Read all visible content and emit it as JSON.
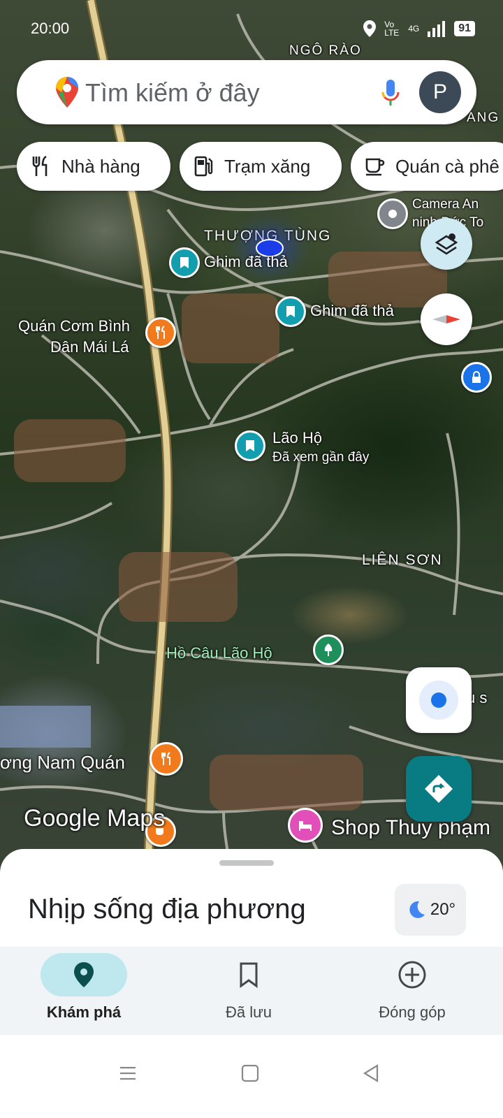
{
  "status_bar": {
    "time": "20:00",
    "network": "Vo LTE",
    "signal": "4G",
    "battery": "91"
  },
  "search": {
    "placeholder": "Tìm kiếm ở đây",
    "avatar_letter": "P"
  },
  "chips": [
    {
      "label": "Nhà hàng",
      "icon": "restaurant-icon"
    },
    {
      "label": "Trạm xăng",
      "icon": "gas-station-icon"
    },
    {
      "label": "Quán cà phê",
      "icon": "coffee-icon"
    }
  ],
  "map_labels": {
    "ngo_rao": "NGÔ RÀO",
    "thuong_tung": "THƯỢNG TÙNG",
    "pin1": "Ghim đã thả",
    "pin2": "Ghim đã thả",
    "quan_com_1": "Quán Cơm Bình",
    "quan_com_2": "Dân Mái Lá",
    "lao_ho": "Lão Hộ",
    "lao_ho_sub": "Đã xem gần đây",
    "lien_son": "LIÊN SƠN",
    "ho_cau": "Hồ Câu Lão Hộ",
    "nam_quan": "ơng Nam Quán",
    "shop": "Shop Thuy phạm",
    "camera_1": "Camera An",
    "camera_2": "ninh Đức To",
    "edge_right": "ANG",
    "edge_right2": "u s",
    "watermark": "Google Maps"
  },
  "sheet": {
    "title": "Nhịp sống địa phương",
    "weather": "20°"
  },
  "nav": {
    "explore": "Khám phá",
    "saved": "Đã lưu",
    "contribute": "Đóng góp"
  },
  "colors": {
    "accent_teal": "#087b83",
    "active_nav": "#bfe8ee"
  }
}
